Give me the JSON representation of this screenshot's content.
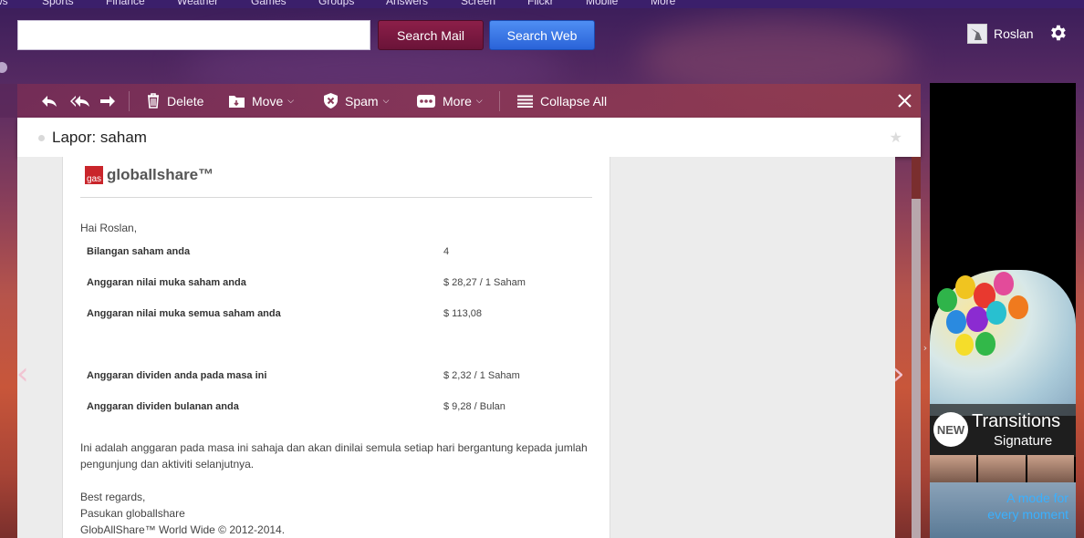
{
  "nav": {
    "items": [
      "ws",
      "Sports",
      "Finance",
      "Weather",
      "Games",
      "Groups",
      "Answers",
      "Screen",
      "Flickr",
      "Mobile",
      "More"
    ]
  },
  "search": {
    "placeholder": "",
    "mail_button": "Search Mail",
    "web_button": "Search Web"
  },
  "user": {
    "name": "Roslan"
  },
  "toolbar": {
    "delete": "Delete",
    "move": "Move",
    "spam": "Spam",
    "more": "More",
    "collapse_all": "Collapse All"
  },
  "message": {
    "subject": "Lapor: saham",
    "logo_mark": "gas",
    "logo_text": "globallshare™",
    "greeting": "Hai Roslan,",
    "rows": [
      {
        "label": "Bilangan saham anda",
        "value": "4"
      },
      {
        "label": "Anggaran nilai muka saham anda",
        "value": "$ 28,27 / 1 Saham"
      },
      {
        "label": "Anggaran nilai muka semua saham anda",
        "value": "$ 113,08"
      },
      {
        "label": "Anggaran dividen anda pada masa ini",
        "value": "$ 2,32 / 1 Saham"
      },
      {
        "label": "Anggaran dividen bulanan anda",
        "value": "$ 9,28 / Bulan"
      }
    ],
    "paragraph": "Ini adalah anggaran pada masa ini sahaja dan akan dinilai semula setiap hari bergantung kepada jumlah pengunjung dan aktiviti selanjutnya.",
    "sign_1": "Best regards,",
    "sign_2": "Pasukan globallshare",
    "sign_3": "GlobAllShare™ World Wide © 2012-2014."
  },
  "ad": {
    "new_badge": "NEW",
    "brand": "Transitions",
    "sub": "Signature",
    "tagline_1": "A mode for",
    "tagline_2": "every moment"
  },
  "colors": {
    "mail_button": "#7a1a40",
    "web_button": "#3a78e6",
    "logo_red": "#c9252b"
  }
}
